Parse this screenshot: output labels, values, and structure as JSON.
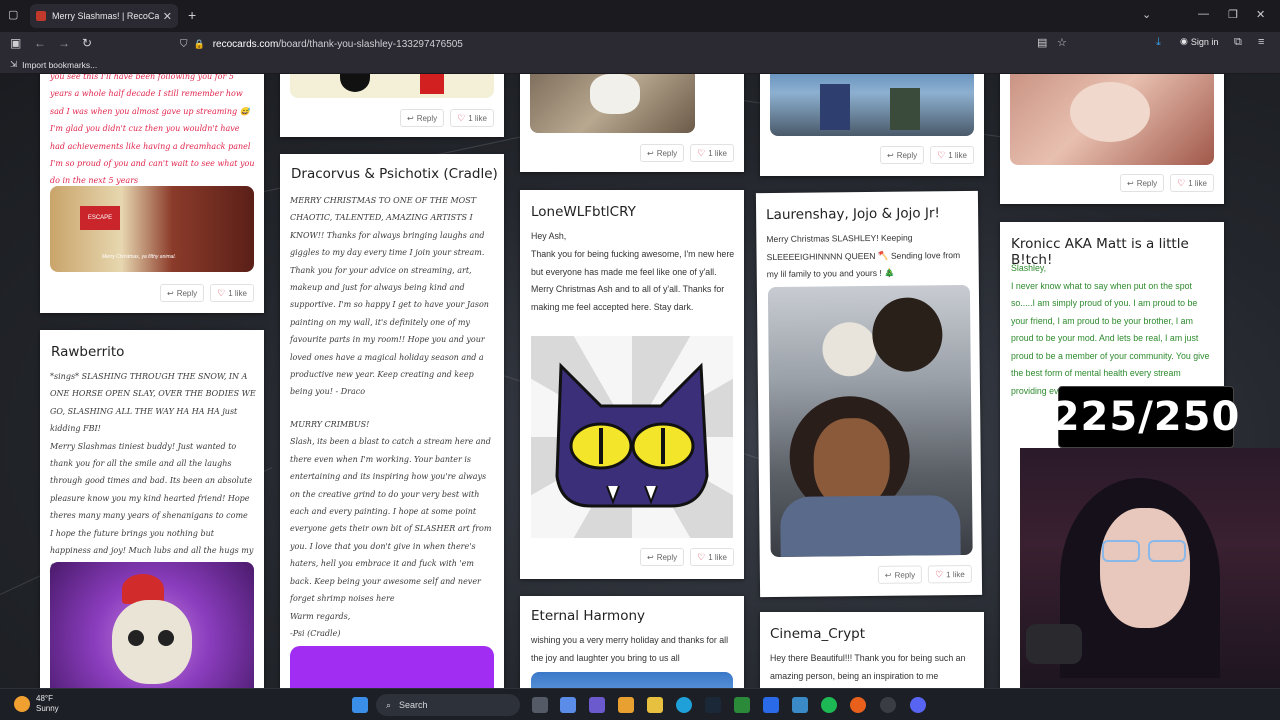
{
  "browser": {
    "tab_title": "Merry Slashmas! | RecoCards.co",
    "url_host": "recocards.com",
    "url_path": "/board/thank-you-slashley-133297476505",
    "sign_in": "Sign in",
    "bookmark": "Import bookmarks..."
  },
  "cards": {
    "c1": {
      "text": "you see this I'll have been following you for 5 years a whole half decade I still remember how sad I was when you almost gave up streaming 😅 I'm glad you didn't cuz then you wouldn't have had achievements like having a dreamhack panel I'm so proud of you and can't wait to see what you do in the next 5 years",
      "caption": "Merry Christmas, ya filthy animal.",
      "sign": "ESCAPE",
      "reply": "Reply",
      "likes": "1 like"
    },
    "c2": {
      "title": "Rawberrito",
      "text": "*sings* SLASHING THROUGH THE SNOW, IN A ONE HORSE OPEN SLAY, OVER THE BODIES WE GO, SLASHING ALL THE WAY HA HA HA just kidding FBI!\nMerry Slashmas tiniest buddy! Just wanted to thank you for all the smile and all the laughs through good times and bad. Its been an absolute pleasure know you my kind hearted friend! Hope theres many many years of shenanigans to come\nI hope the future brings you nothing but happiness and joy! Much lubs and all the hugs my friend!"
    },
    "c3": {
      "reply": "Reply",
      "likes": "1 like",
      "title": "Dracorvus & Psichotix (Cradle)",
      "text": "MERRY CHRISTMAS TO ONE OF THE MOST CHAOTIC, TALENTED, AMAZING ARTISTS I KNOW!! Thanks for always bringing laughs and giggles to my day every time I join your stream. Thank you for your advice on streaming, art, makeup and just for always being kind and supportive. I'm so happy I get to have your Jason painting on my wall, it's definitely one of my favourite parts in my room!! Hope you and your loved ones have a magical holiday season and a productive new year. Keep creating and keep being you! - Draco",
      "text2": "MURRY CRIMBUS!\nSlash, its been a blast to catch a stream here and there even when I'm working. Your banter is entertaining and its inspiring how you're always on the creative grind to do your very best with each and every painting. I hope at some point everyone gets their own bit of SLASHER art from you. I love that you don't give in when there's haters, hell you embrace it and fuck with 'em back. Keep being your awesome self and never forget shrimp noises here",
      "sign1": "Warm regards,",
      "sign2": "-Psi (Cradle)"
    },
    "c4": {
      "reply": "Reply",
      "likes": "1 like",
      "title": "LoneWLFbtlCRY",
      "greeting": "Hey Ash,",
      "text": "Thank you for being fucking awesome, I'm new here but everyone has made me feel like one of y'all. Merry Christmas Ash and to all of y'all. Thanks for making me feel accepted here. Stay dark.",
      "reply2": "Reply",
      "likes2": "1 like"
    },
    "c5": {
      "title": "Eternal Harmony",
      "text": "wishing you a very merry holiday and thanks for all the joy and laughter you bring to us all"
    },
    "c6": {
      "reply": "Reply",
      "likes": "1 like",
      "title": "Laurenshay, Jojo & Jojo Jr!",
      "text": "Merry Christmas SLASHLEY! Keeping SLEEEEIGHINNNN QUEEN 🪓 Sending love from my lil family to you and yours ! 🎄",
      "reply2": "Reply",
      "likes2": "1 like"
    },
    "c7": {
      "title": "Cinema_Crypt",
      "text": "Hey there Beautiful!!! Thank you for being such an amazing person, being an inspiration to me"
    },
    "c8": {
      "reply": "Reply",
      "likes": "1 like",
      "title": "Kronicc AKA Matt is a little B!tch!",
      "text": "Slashley,\n I never know what to say when put on the spot so.....I am simply proud of you. I am proud to be your friend, I am proud to be your brother, I am proud to be your mod. And lets be real, I am just proud to be a member of your community. You give the best form of mental health every stream providing every safe place"
    },
    "c2r": {
      "reply": "Reply",
      "likes": "1 like"
    }
  },
  "overlay": {
    "counter": "225/250"
  },
  "taskbar": {
    "temp": "48°F",
    "cond": "Sunny",
    "search": "Search"
  }
}
